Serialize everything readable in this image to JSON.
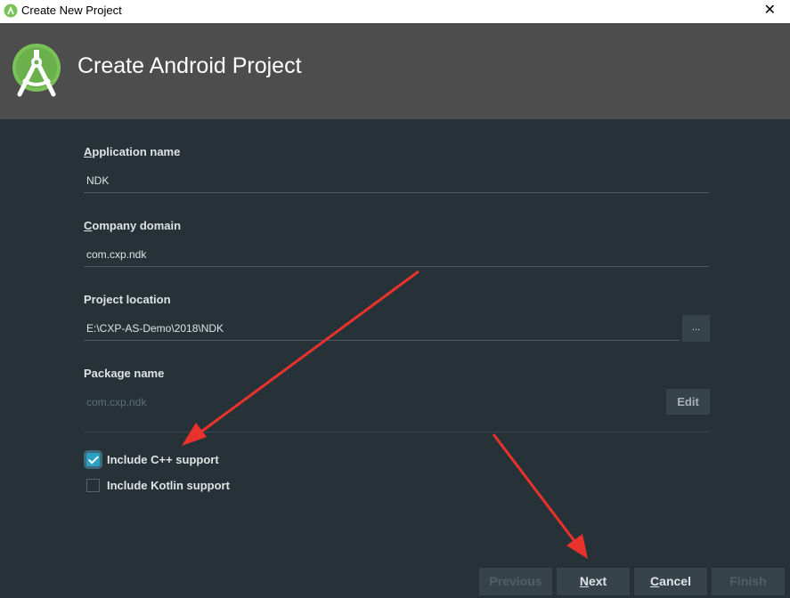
{
  "window": {
    "title": "Create New Project",
    "close_glyph": "✕"
  },
  "header": {
    "title": "Create Android Project",
    "logo_icon": "android-studio-logo-icon"
  },
  "form": {
    "app_name": {
      "label_key": "A",
      "label_rest": "pplication name",
      "value": "NDK"
    },
    "company_domain": {
      "label_key": "C",
      "label_rest": "ompany domain",
      "value": "com.cxp.ndk"
    },
    "project_location": {
      "label": "Project location",
      "value": "E:\\CXP-AS-Demo\\2018\\NDK",
      "browse_label": "..."
    },
    "package_name": {
      "label": "Package name",
      "value": "com.cxp.ndk",
      "edit_label": "Edit"
    },
    "include_cpp": {
      "label": "Include C++ support",
      "checked": true
    },
    "include_kotlin": {
      "label": "Include Kotlin support",
      "checked": false
    }
  },
  "buttons": {
    "previous": "Previous",
    "next_key": "N",
    "next_rest": "ext",
    "cancel_key": "C",
    "cancel_rest": "ancel",
    "finish": "Finish"
  },
  "colors": {
    "accent": "#2aa1c4",
    "annotation_arrow": "#e8322b",
    "background": "#263238",
    "header": "#4d4d4d"
  }
}
